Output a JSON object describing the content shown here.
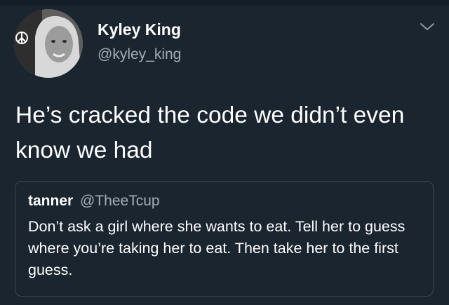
{
  "tweet": {
    "author": {
      "display_name": "Kyley King",
      "handle": "@kyley_king",
      "avatar_icon": "profile-photo"
    },
    "text": "He’s cracked the code we didn’t even know we had",
    "menu_icon": "chevron-down-icon"
  },
  "quoted_tweet": {
    "display_name": "tanner",
    "handle": "@TheeTcup",
    "text": "Don’t ask a girl where she wants to eat. Tell her to guess where you’re taking her to eat. Then take her to the first guess."
  },
  "colors": {
    "background": "#1b2530",
    "primary_text": "#ffffff",
    "secondary_text": "#a3adb8",
    "card_border": "#3a4754"
  }
}
